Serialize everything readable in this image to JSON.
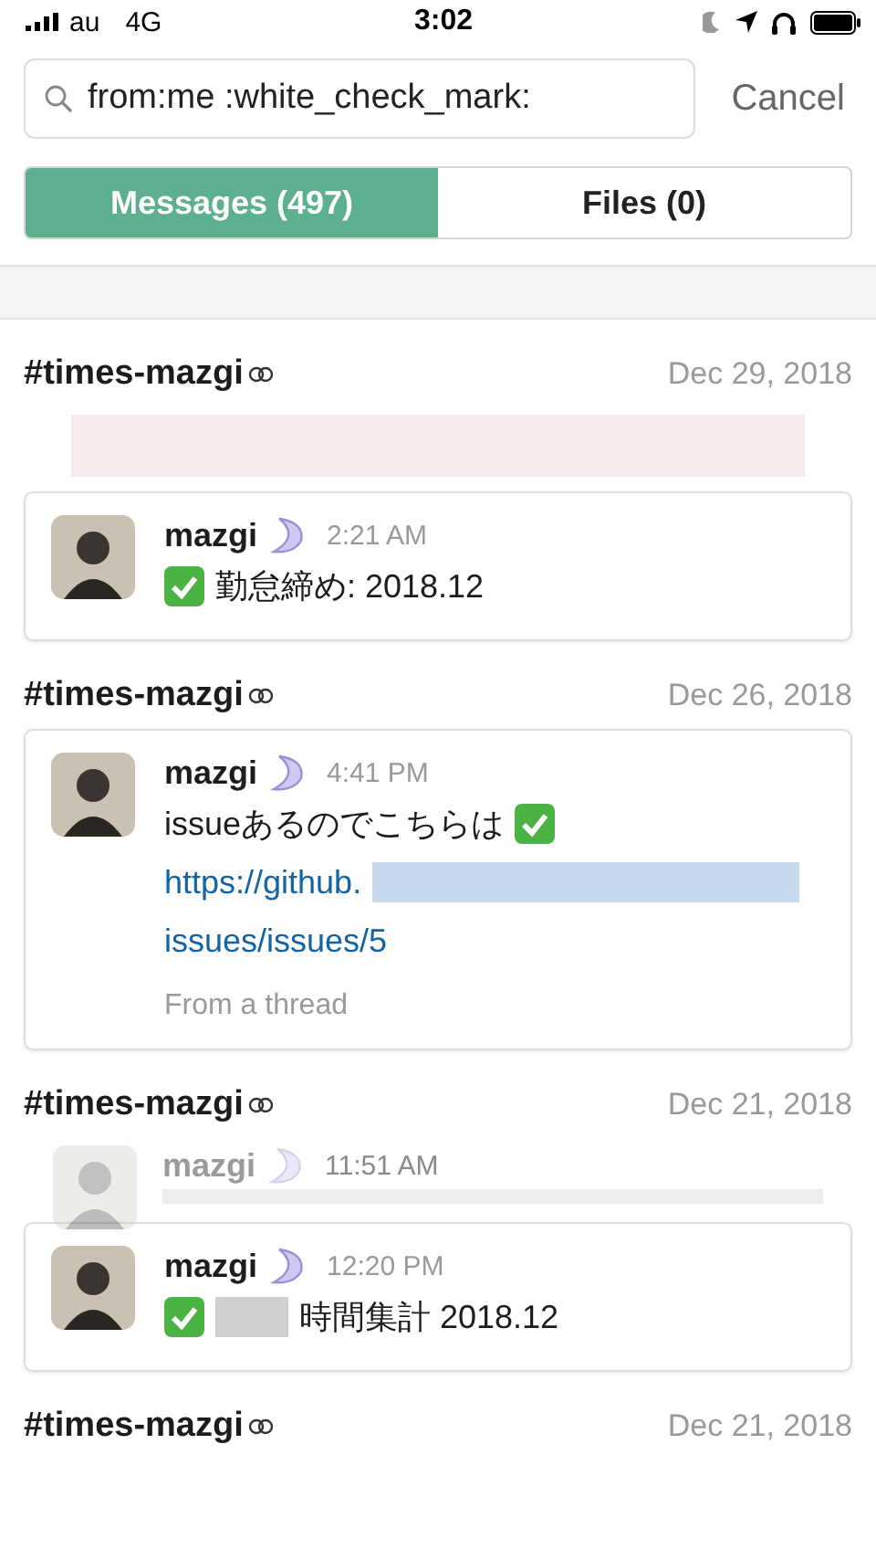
{
  "status_bar": {
    "carrier": "au",
    "network": "4G",
    "time": "3:02"
  },
  "search": {
    "value": "from:me :white_check_mark:",
    "cancel": "Cancel"
  },
  "tabs": [
    {
      "label": "Messages (497)",
      "selected": true
    },
    {
      "label": "Files (0)",
      "selected": false
    }
  ],
  "results": [
    {
      "channel": "#times-mazgi",
      "date": "Dec 29, 2018",
      "context": {
        "kind": "blurred"
      },
      "message": {
        "name": "mazgi",
        "time": "2:21 AM",
        "lines": [
          [
            {
              "kind": "check"
            },
            {
              "kind": "text",
              "text": "勤怠締め: 2018.12"
            }
          ]
        ]
      }
    },
    {
      "channel": "#times-mazgi",
      "date": "Dec 26, 2018",
      "message": {
        "name": "mazgi",
        "time": "4:41 PM",
        "lines": [
          [
            {
              "kind": "text",
              "text": "issueあるのでこちらは"
            },
            {
              "kind": "check"
            }
          ],
          [
            {
              "kind": "link",
              "text": "https://github."
            },
            {
              "kind": "redacted-link"
            }
          ],
          [
            {
              "kind": "link",
              "text": "issues/issues/5"
            }
          ]
        ],
        "footer": "From a thread"
      }
    },
    {
      "channel": "#times-mazgi",
      "date": "Dec 21, 2018",
      "context": {
        "kind": "message",
        "name": "mazgi",
        "time": "11:51 AM"
      },
      "message": {
        "name": "mazgi",
        "time": "12:20 PM",
        "lines": [
          [
            {
              "kind": "check"
            },
            {
              "kind": "redacted-text"
            },
            {
              "kind": "text",
              "text": "時間集計 2018.12"
            }
          ]
        ]
      }
    },
    {
      "channel": "#times-mazgi",
      "date": "Dec 21, 2018"
    }
  ]
}
